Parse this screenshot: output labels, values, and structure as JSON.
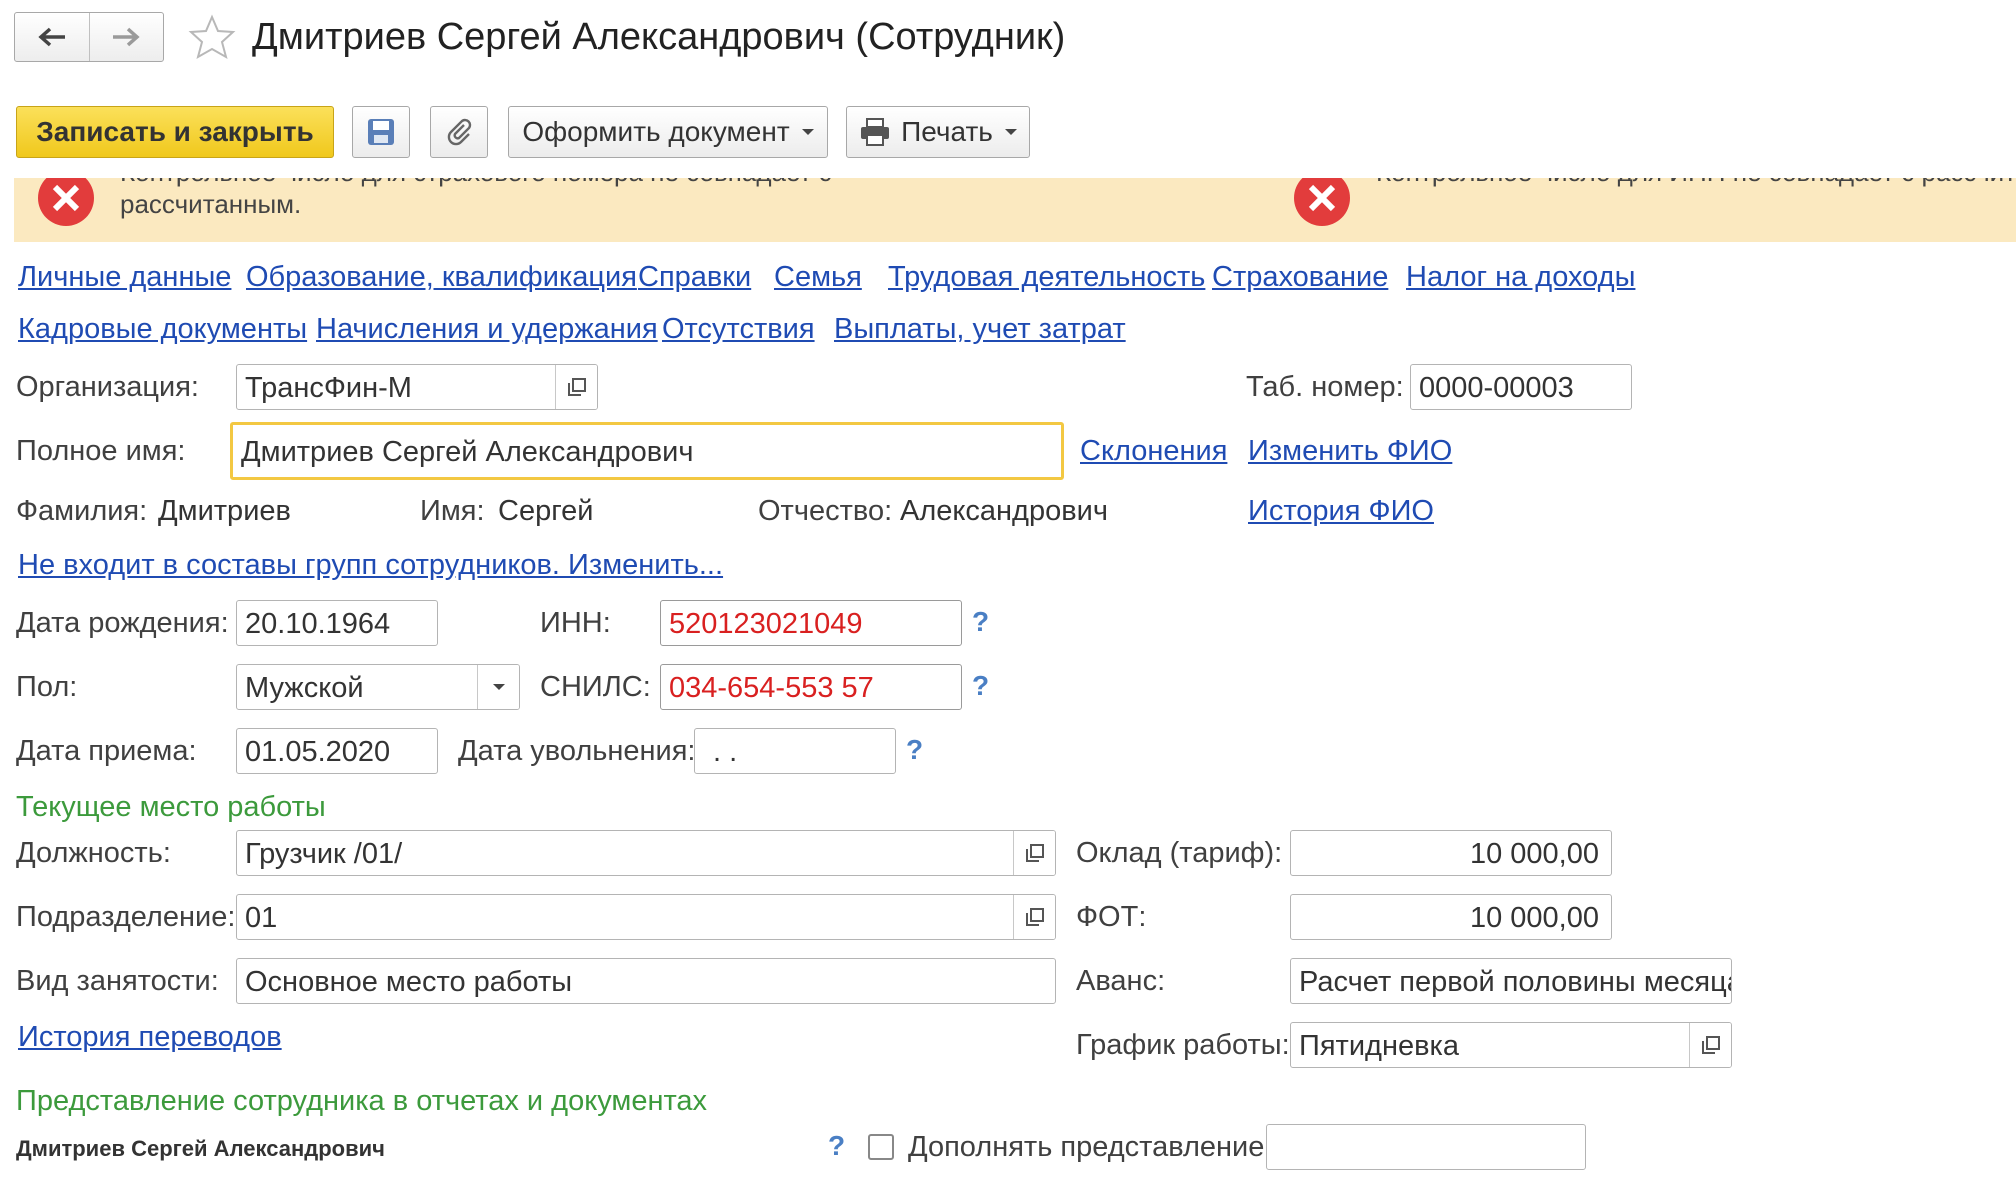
{
  "window": {
    "title": "Дмитриев Сергей Александрович (Сотрудник)"
  },
  "toolbar": {
    "save_close": "Записать и закрыть",
    "create_document": "Оформить документ",
    "print": "Печать"
  },
  "errors": [
    {
      "line1": "Контрольное число для страхового номера не совпадает с",
      "line2": "рассчитанным."
    },
    {
      "line1": "Контрольное число для ИНН не совпадает с рассчитанным.",
      "line2": ""
    }
  ],
  "nav": {
    "row1": [
      "Личные данные",
      "Образование, квалификация",
      "Справки",
      "Семья",
      "Трудовая деятельность",
      "Страхование",
      "Налог на доходы"
    ],
    "row2": [
      "Кадровые документы",
      "Начисления и удержания",
      "Отсутствия",
      "Выплаты, учет затрат"
    ]
  },
  "form": {
    "org_label": "Организация:",
    "org_value": "ТрансФин-М",
    "tab_label": "Таб. номер:",
    "tab_value": "0000-00003",
    "fullname_label": "Полное имя:",
    "fullname_value": "Дмитриев Сергей Александрович",
    "declensions_link": "Склонения",
    "change_fio_link": "Изменить ФИО",
    "surname_label": "Фамилия:",
    "surname_value": "Дмитриев",
    "name_label": "Имя:",
    "name_value": "Сергей",
    "patronymic_label": "Отчество:",
    "patronymic_value": "Александрович",
    "history_fio_link": "История ФИО",
    "groups_link": "Не входит в составы групп сотрудников. Изменить...",
    "birth_label": "Дата рождения:",
    "birth_value": "20.10.1964",
    "inn_label": "ИНН:",
    "inn_value": "520123021049",
    "sex_label": "Пол:",
    "sex_value": "Мужской",
    "snils_label": "СНИЛС:",
    "snils_value": "034-654-553 57",
    "hire_label": "Дата приема:",
    "hire_value": "01.05.2020",
    "fire_label": "Дата увольнения:",
    "fire_value": " .  .",
    "help": "?"
  },
  "workplace": {
    "section_title": "Текущее место работы",
    "position_label": "Должность:",
    "position_value": "Грузчик /01/",
    "salary_label": "Оклад (тариф):",
    "salary_value": "10 000,00",
    "dept_label": "Подразделение:",
    "dept_value": "01",
    "fot_label": "ФОТ:",
    "fot_value": "10 000,00",
    "employment_label": "Вид занятости:",
    "employment_value": "Основное место работы",
    "advance_label": "Аванс:",
    "advance_value": "Расчет первой половины месяца",
    "history_link": "История переводов",
    "schedule_label": "График работы:",
    "schedule_value": "Пятидневка"
  },
  "presentation": {
    "section_title": "Представление сотрудника в отчетах и документах",
    "value": "Дмитриев Сергей Александрович",
    "checkbox_label": "Дополнять представление",
    "extra_value": ""
  }
}
